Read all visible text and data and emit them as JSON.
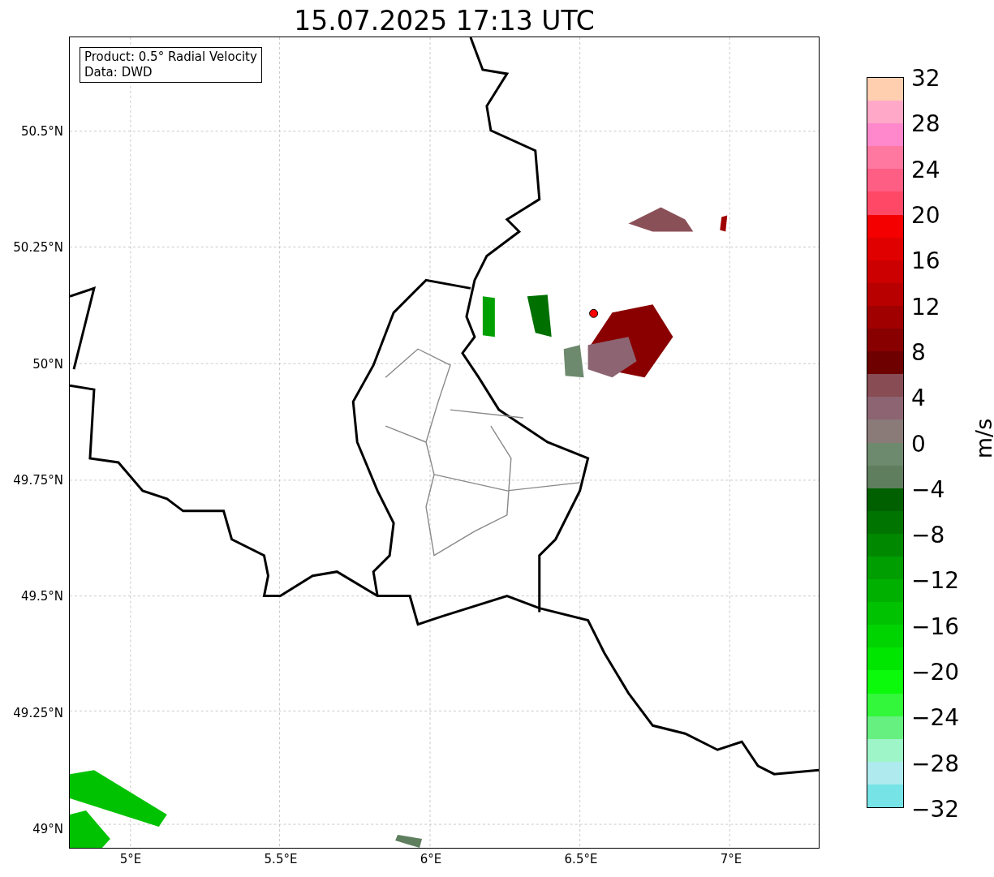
{
  "title": "15.07.2025 17:13 UTC",
  "info_box": {
    "lines": [
      "Product: 0.5° Radial Velocity",
      "Data: DWD"
    ]
  },
  "map": {
    "y_ticks": [
      "50.5°N",
      "50.25°N",
      "50°N",
      "49.75°N",
      "49.5°N",
      "49.25°N",
      "49°N"
    ],
    "x_ticks": [
      "5°E",
      "5.5°E",
      "6°E",
      "6.5°E",
      "7°E"
    ]
  },
  "colorbar": {
    "label": "m/s",
    "ticks": [
      "32",
      "28",
      "24",
      "20",
      "16",
      "12",
      "8",
      "4",
      "0",
      "−4",
      "−8",
      "−12",
      "−16",
      "−20",
      "−24",
      "−28",
      "−32"
    ],
    "bands": [
      {
        "color": "#ffcfb0"
      },
      {
        "color": "#ffa8c8"
      },
      {
        "color": "#ff88cc"
      },
      {
        "color": "#ff78a0"
      },
      {
        "color": "#ff5e84"
      },
      {
        "color": "#ff4866"
      },
      {
        "color": "#f40000"
      },
      {
        "color": "#e00000"
      },
      {
        "color": "#cc0000"
      },
      {
        "color": "#b80000"
      },
      {
        "color": "#a00000"
      },
      {
        "color": "#880000"
      },
      {
        "color": "#6e0000"
      },
      {
        "color": "#884c54"
      },
      {
        "color": "#8c6472"
      },
      {
        "color": "#8a7a78"
      },
      {
        "color": "#6e8a6e"
      },
      {
        "color": "#5e7e5e"
      },
      {
        "color": "#006000"
      },
      {
        "color": "#007400"
      },
      {
        "color": "#008800"
      },
      {
        "color": "#009e00"
      },
      {
        "color": "#00b000"
      },
      {
        "color": "#00c200"
      },
      {
        "color": "#00d400"
      },
      {
        "color": "#00e600"
      },
      {
        "color": "#0bf90b"
      },
      {
        "color": "#33f73a"
      },
      {
        "color": "#66f080"
      },
      {
        "color": "#9ef5c8"
      },
      {
        "color": "#aeeaee"
      },
      {
        "color": "#76e3e6"
      }
    ]
  }
}
